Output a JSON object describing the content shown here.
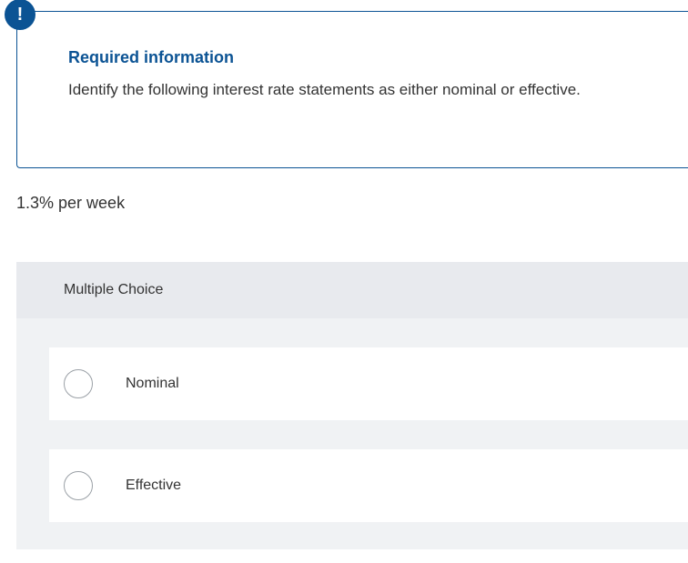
{
  "info": {
    "badge": "!",
    "title": "Required information",
    "text": "Identify the following interest rate statements as either nominal or effective."
  },
  "question": "1.3% per week",
  "mc": {
    "header": "Multiple Choice",
    "options": [
      {
        "label": "Nominal"
      },
      {
        "label": "Effective"
      }
    ]
  }
}
